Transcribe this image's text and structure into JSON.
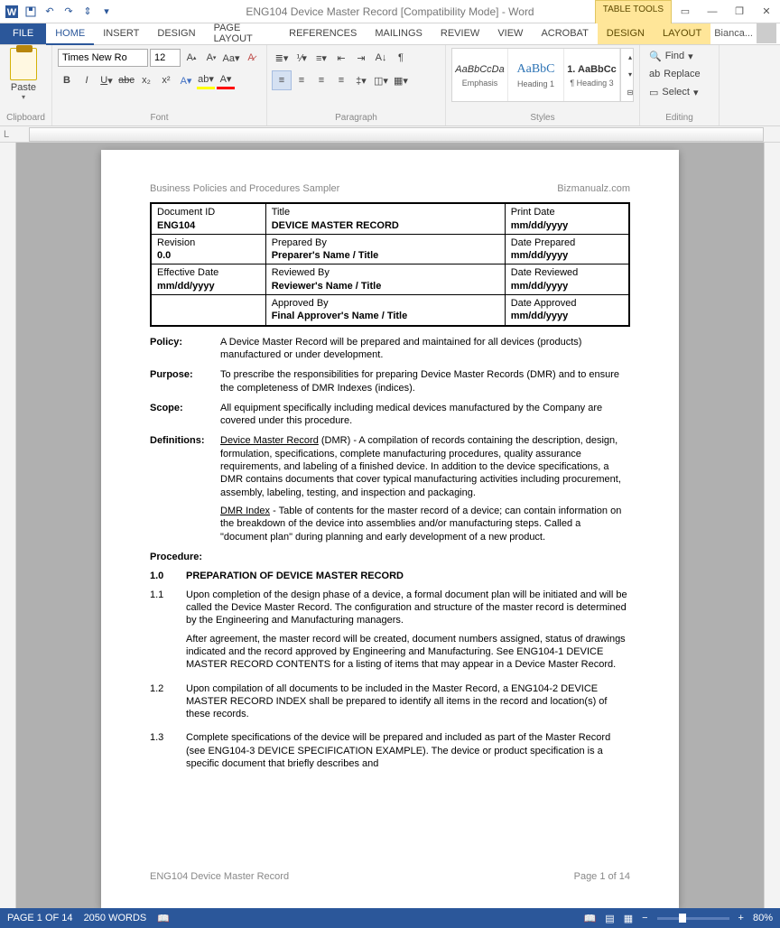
{
  "titlebar": {
    "title": "ENG104 Device Master Record [Compatibility Mode] - Word",
    "contextTab": "TABLE TOOLS",
    "user": "Bianca..."
  },
  "tabs": {
    "file": "FILE",
    "home": "HOME",
    "insert": "INSERT",
    "design": "DESIGN",
    "pageLayout": "PAGE LAYOUT",
    "references": "REFERENCES",
    "mailings": "MAILINGS",
    "review": "REVIEW",
    "view": "VIEW",
    "acrobat": "ACROBAT",
    "tDesign": "DESIGN",
    "tLayout": "LAYOUT"
  },
  "ribbon": {
    "clipboard": {
      "label": "Clipboard",
      "paste": "Paste"
    },
    "font": {
      "label": "Font",
      "name": "Times New Ro",
      "size": "12"
    },
    "paragraph": {
      "label": "Paragraph"
    },
    "styles": {
      "label": "Styles",
      "items": [
        {
          "preview": "AaBbCcDa",
          "name": "Emphasis"
        },
        {
          "preview": "AaBbC",
          "name": "Heading 1"
        },
        {
          "preview": "1. AaBbCc",
          "name": "¶ Heading 3"
        }
      ]
    },
    "editing": {
      "label": "Editing",
      "find": "Find",
      "replace": "Replace",
      "select": "Select"
    }
  },
  "document": {
    "headerLeft": "Business Policies and Procedures Sampler",
    "headerRight": "Bizmanualz.com",
    "footerLeft": "ENG104 Device Master Record",
    "footerRight": "Page 1 of 14",
    "table": {
      "r1": {
        "l1": "Document ID",
        "v1": "ENG104",
        "l2": "Title",
        "v2": "DEVICE MASTER RECORD",
        "l3": "Print Date",
        "v3": "mm/dd/yyyy"
      },
      "r2": {
        "l1": "Revision",
        "v1": "0.0",
        "l2": "Prepared By",
        "v2": "Preparer's Name / Title",
        "l3": "Date Prepared",
        "v3": "mm/dd/yyyy"
      },
      "r3": {
        "l1": "Effective Date",
        "v1": "mm/dd/yyyy",
        "l2": "Reviewed By",
        "v2": "Reviewer's Name / Title",
        "l3": "Date Reviewed",
        "v3": "mm/dd/yyyy"
      },
      "r4": {
        "l1": "",
        "v1": "",
        "l2": "Approved By",
        "v2": "Final Approver's Name / Title",
        "l3": "Date Approved",
        "v3": "mm/dd/yyyy"
      }
    },
    "sections": {
      "policyL": "Policy:",
      "policy": "A Device Master Record will be prepared and maintained for all devices (products) manufactured or under development.",
      "purposeL": "Purpose:",
      "purpose": "To prescribe the responsibilities for preparing Device Master Records (DMR) and to ensure the completeness of DMR Indexes (indices).",
      "scopeL": "Scope:",
      "scope": "All equipment specifically including medical devices manufactured by the Company are covered under this procedure.",
      "defsL": "Definitions:",
      "defsTerm": "Device Master Record",
      "defs1": " (DMR) - A compilation of records containing the description, design, formulation, specifications, complete manufacturing procedures, quality assurance requirements, and labeling of a finished device.  In addition to the device specifications, a DMR contains documents that cover typical manufacturing activities including procurement, assembly, labeling, testing, and inspection and packaging.",
      "defs2Term": "DMR Index",
      "defs2": " - Table of contents for the master record of a device; can contain information on the breakdown of the device into assemblies and/or manufacturing steps.  Called a \"document plan\" during planning and early development of a new product.",
      "procedureL": "Procedure:",
      "h1num": "1.0",
      "h1txt": "PREPARATION OF DEVICE MASTER RECORD",
      "i11n": "1.1",
      "i11a": "Upon completion of the design phase of a device, a formal document plan will be initiated and will be called the Device Master Record.  The configuration and structure of the master record is determined by the Engineering and Manufacturing managers.",
      "i11b": "After agreement, the master record will be created, document numbers assigned, status of drawings indicated and the record approved by Engineering and Manufacturing.  See ENG104-1 DEVICE MASTER RECORD CONTENTS for a listing of items that may appear in a Device Master Record.",
      "i12n": "1.2",
      "i12": "Upon compilation of all documents to be included in the Master Record, a ENG104-2 DEVICE MASTER RECORD INDEX shall be prepared to identify all items in the record and location(s) of these records.",
      "i13n": "1.3",
      "i13": "Complete specifications of the device will be prepared and included as part of the Master Record (see ENG104-3 DEVICE SPECIFICATION EXAMPLE).  The device or product specification is a specific document that briefly describes and"
    }
  },
  "status": {
    "page": "PAGE 1 OF 14",
    "words": "2050 WORDS",
    "zoom": "80%"
  }
}
